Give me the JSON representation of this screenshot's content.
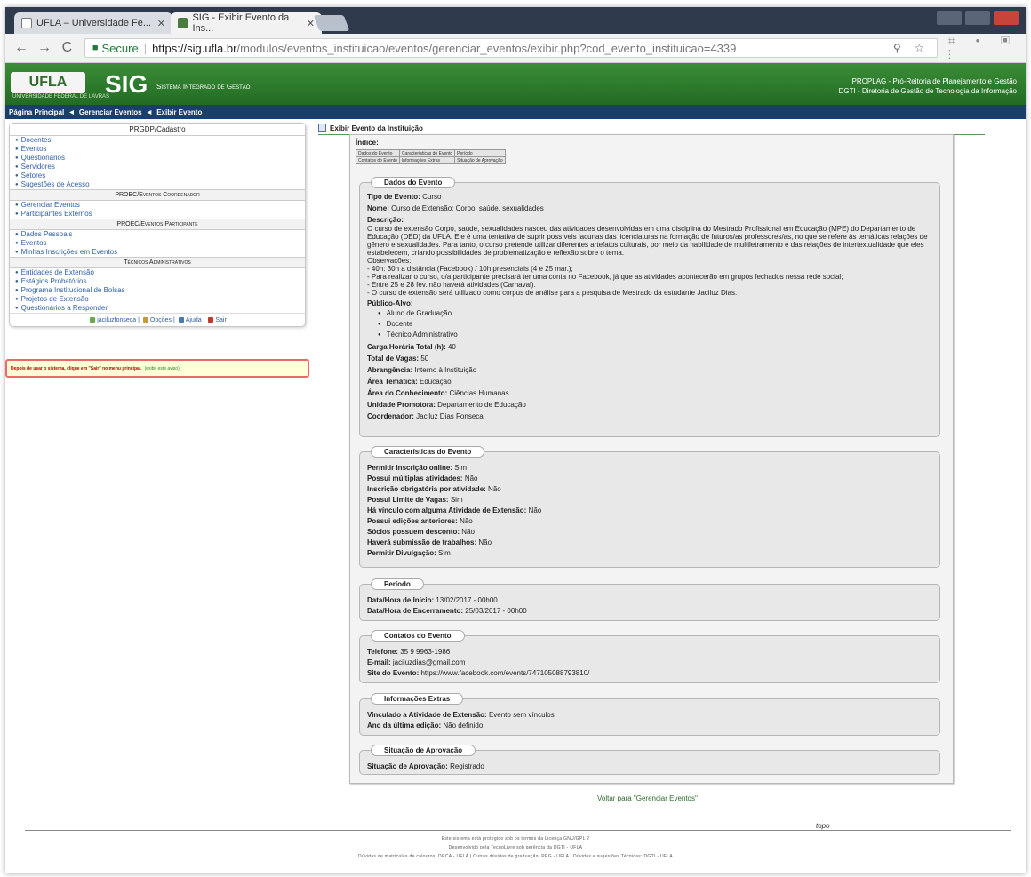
{
  "browser": {
    "tabs": [
      {
        "label": "UFLA – Universidade Fe..."
      },
      {
        "label": "SIG - Exibir Evento da Ins..."
      }
    ],
    "secure_label": "Secure",
    "url_host": "https://sig.ufla.br",
    "url_path": "/modulos/eventos_instituicao/eventos/gerenciar_eventos/exibir.php?cod_evento_instituicao=4339"
  },
  "header": {
    "logo": "UFLA",
    "logo_sub": "UNIVERSIDADE FEDERAL DE LAVRAS",
    "title": "SIG",
    "subtitle": "Sistema Integrado de Gestão",
    "right_line1": "PROPLAG - Pró-Reitoria de Planejamento e Gestão",
    "right_line2": "DGTI - Diretoria de Gestão de Tecnologia da Informação"
  },
  "breadcrumb": {
    "items": [
      "Página Principal",
      "Gerenciar Eventos",
      "Exibir Evento"
    ]
  },
  "sidebar": {
    "groups": [
      {
        "title": "PRGDP/Cadastro",
        "items": [
          "Docentes",
          "Eventos",
          "Questionários",
          "Servidores",
          "Setores",
          "Sugestões de Acesso"
        ]
      },
      {
        "title": "PROEC/Eventos Coordenador",
        "items": [
          "Gerenciar Eventos",
          "Participantes Externos"
        ]
      },
      {
        "title": "PROEC/Eventos Participante",
        "items": [
          "Dados Pessoais",
          "Eventos",
          "Minhas Inscrições em Eventos"
        ]
      },
      {
        "title": "Técnicos Administrativos",
        "items": [
          "Entidades de Extensão",
          "Estágios Probatórios",
          "Programa Institucional de Bolsas",
          "Projetos de Extensão",
          "Questionários a Responder"
        ]
      }
    ],
    "footer": {
      "user": "jaciluzfonseca",
      "options": "Opções",
      "help": "Ajuda",
      "exit": "Sair"
    }
  },
  "warning": {
    "text": "Depois de usar o sistema, clique em \"Sair\" no menu principal.",
    "link": "(exibir este aviso)"
  },
  "page": {
    "title": "Exibir Evento da Instituição",
    "index_label": "Índice:",
    "index_links": [
      [
        "Dados do Evento",
        "Características do Evento",
        "Período"
      ],
      [
        "Contatos do Evento",
        "Informações Extras",
        "Situação de Aprovação"
      ]
    ]
  },
  "dados": {
    "legend": "Dados do Evento",
    "tipo_label": "Tipo de Evento:",
    "tipo": "Curso",
    "nome_label": "Nome:",
    "nome": "Curso de Extensão: Corpo, saúde, sexualidades",
    "descricao_label": "Descrição:",
    "descricao": "O curso de extensão Corpo, saúde, sexualidades nasceu das atividades desenvolvidas em uma disciplina do Mestrado Profissional em Educação (MPE) do Departamento de Educação (DED) da UFLA. Ele é uma tentativa de suprir possíveis lacunas das licenciaturas na formação de futuros/as professores/as, no que se refere às temáticas relações de gênero e sexualidades. Para tanto, o curso pretende utilizar diferentes artefatos culturais, por meio da habilidade de multiletramento e das relações de intertextualidade que eles estabelecem, criando possibilidades de problematização e reflexão sobre o tema.",
    "observacoes": [
      "Observações:",
      "- 40h: 30h a distância (Facebook) / 10h presenciais (4 e 25 mar.);",
      "- Para realizar o curso, o/a participante precisará ter uma conta no Facebook, já que as atividades acontecerão em grupos fechados nessa rede social;",
      "- Entre 25 e 28 fev. não haverá atividades (Carnaval).",
      "- O curso de extensão será utilizado como corpus de análise para a pesquisa de Mestrado da estudante Jaciluz Dias."
    ],
    "publico_label": "Público-Alvo:",
    "publico": [
      "Aluno de Graduação",
      "Docente",
      "Técnico Administrativo"
    ],
    "carga_label": "Carga Horária Total (h):",
    "carga": "40",
    "vagas_label": "Total de Vagas:",
    "vagas": "50",
    "abrangencia_label": "Abrangência:",
    "abrangencia": "Interno à Instituição",
    "area_label": "Área Temática:",
    "area": "Educação",
    "conhecimento_label": "Área do Conhecimento:",
    "conhecimento": "Ciências Humanas",
    "unidade_label": "Unidade Promotora:",
    "unidade": "Departamento de Educação",
    "coord_label": "Coordenador:",
    "coord": "Jaciluz Dias Fonseca"
  },
  "caracteristicas": {
    "legend": "Características do Evento",
    "rows": [
      {
        "label": "Permitir inscrição online:",
        "value": "Sim"
      },
      {
        "label": "Possui múltiplas atividades:",
        "value": "Não"
      },
      {
        "label": "Inscrição obrigatória por atividade:",
        "value": "Não"
      },
      {
        "label": "Possui Limite de Vagas:",
        "value": "Sim"
      },
      {
        "label": "Há vínculo com alguma Atividade de Extensão:",
        "value": "Não"
      },
      {
        "label": "Possui edições anteriores:",
        "value": "Não"
      },
      {
        "label": "Sócios possuem desconto:",
        "value": "Não"
      },
      {
        "label": "Haverá submissão de trabalhos:",
        "value": "Não"
      },
      {
        "label": "Permitir Divulgação:",
        "value": "Sim"
      }
    ]
  },
  "periodo": {
    "legend": "Período",
    "rows": [
      {
        "label": "Data/Hora de Início:",
        "value": "13/02/2017 - 00h00"
      },
      {
        "label": "Data/Hora de Encerramento:",
        "value": "25/03/2017 - 00h00"
      }
    ]
  },
  "contatos": {
    "legend": "Contatos do Evento",
    "rows": [
      {
        "label": "Telefone:",
        "value": "35 9 9963-1986"
      },
      {
        "label": "E-mail:",
        "value": "jaciluzdias@gmail.com"
      },
      {
        "label": "Site do Evento:",
        "value": "https://www.facebook.com/events/747105088793810/"
      }
    ]
  },
  "extras": {
    "legend": "Informações Extras",
    "rows": [
      {
        "label": "Vinculado a Atividade de Extensão:",
        "value": "Evento sem vínculos"
      },
      {
        "label": "Ano da última edição:",
        "value": "Não definido"
      }
    ]
  },
  "situacao": {
    "legend": "Situação de Aprovação",
    "rows": [
      {
        "label": "Situação de Aprovação:",
        "value": "Registrado"
      }
    ]
  },
  "voltar": "Voltar para \"Gerenciar Eventos\"",
  "topo": "topo",
  "footer": {
    "line1": "Este sistema está protegido sob os termos da Licença GNU/GPL 2",
    "line2": "Desenvolvido pela TecnoLivre sob gerência da DGTI - UFLA",
    "line3": "Dúvidas de matrículas de calouros: DRCA - UFLA | Outras dúvidas de graduação: PRG - UFLA | Dúvidas e sugestões Técnicas: DGTI - UFLA"
  }
}
